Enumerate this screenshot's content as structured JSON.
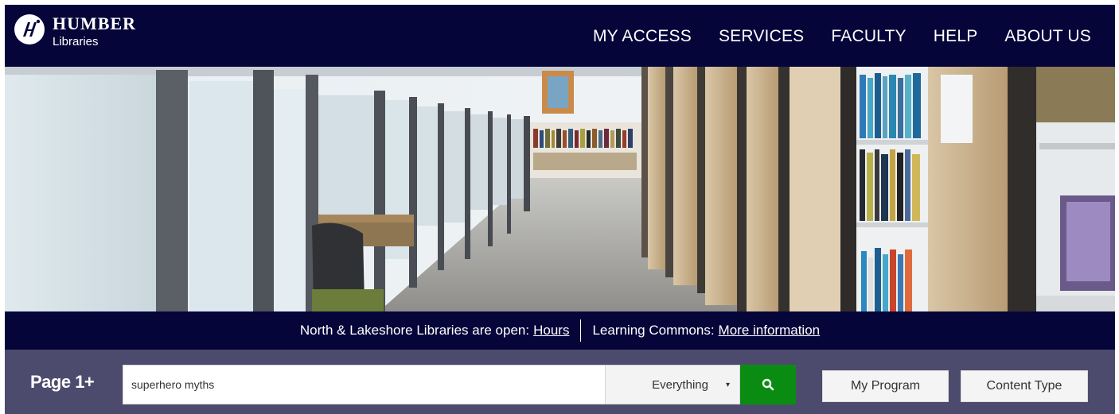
{
  "header": {
    "logo_brand": "HUMBER",
    "logo_sub": "Libraries",
    "nav": [
      "MY ACCESS",
      "SERVICES",
      "FACULTY",
      "HELP",
      "ABOUT US"
    ]
  },
  "hero": {
    "description": "library-study-carrels-and-bookshelves-photo"
  },
  "infobar": {
    "open_text": "North & Lakeshore Libraries are open:",
    "hours_link": "Hours",
    "commons_text": "Learning Commons:",
    "commons_link": "More information"
  },
  "search": {
    "brand": "Page 1+",
    "query": "superhero myths",
    "scope": "Everything",
    "scope_caret": "▾",
    "search_icon": "search-icon",
    "filter_program": "My Program",
    "filter_content_type": "Content Type"
  },
  "colors": {
    "header_bg": "#06053a",
    "search_bg": "#4d4b6d",
    "search_button": "#0a8c12"
  }
}
